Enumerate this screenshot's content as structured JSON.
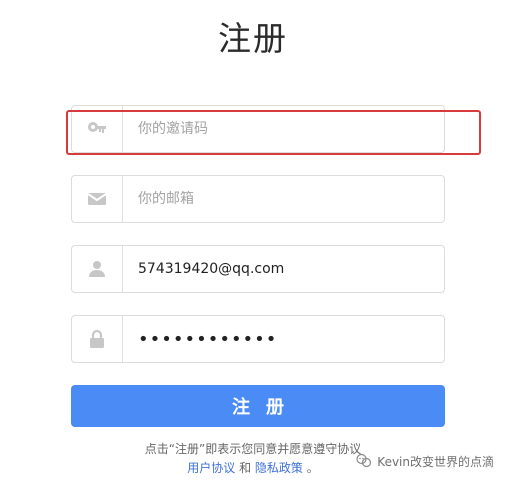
{
  "title": "注册",
  "fields": {
    "invite": {
      "placeholder": "你的邀请码",
      "value": ""
    },
    "email": {
      "placeholder": "你的邮箱",
      "value": ""
    },
    "username": {
      "placeholder": "",
      "value": "574319420@qq.com"
    },
    "password": {
      "value": "••••••••••••"
    }
  },
  "submit_label": "注册",
  "terms": {
    "prefix": "点击“注册”即表示您同意并愿意遵守协议",
    "user_agreement": "用户协议",
    "and": "和",
    "privacy_policy": "隐私政策",
    "suffix": "。"
  },
  "watermark": "Kevin改变世界的点滴",
  "colors": {
    "primary": "#4a8bf5",
    "highlight": "#d83b3b",
    "link": "#4171d6"
  },
  "icons": {
    "invite": "key-icon",
    "email": "envelope-icon",
    "username": "user-icon",
    "password": "lock-icon",
    "watermark": "wechat-icon"
  }
}
